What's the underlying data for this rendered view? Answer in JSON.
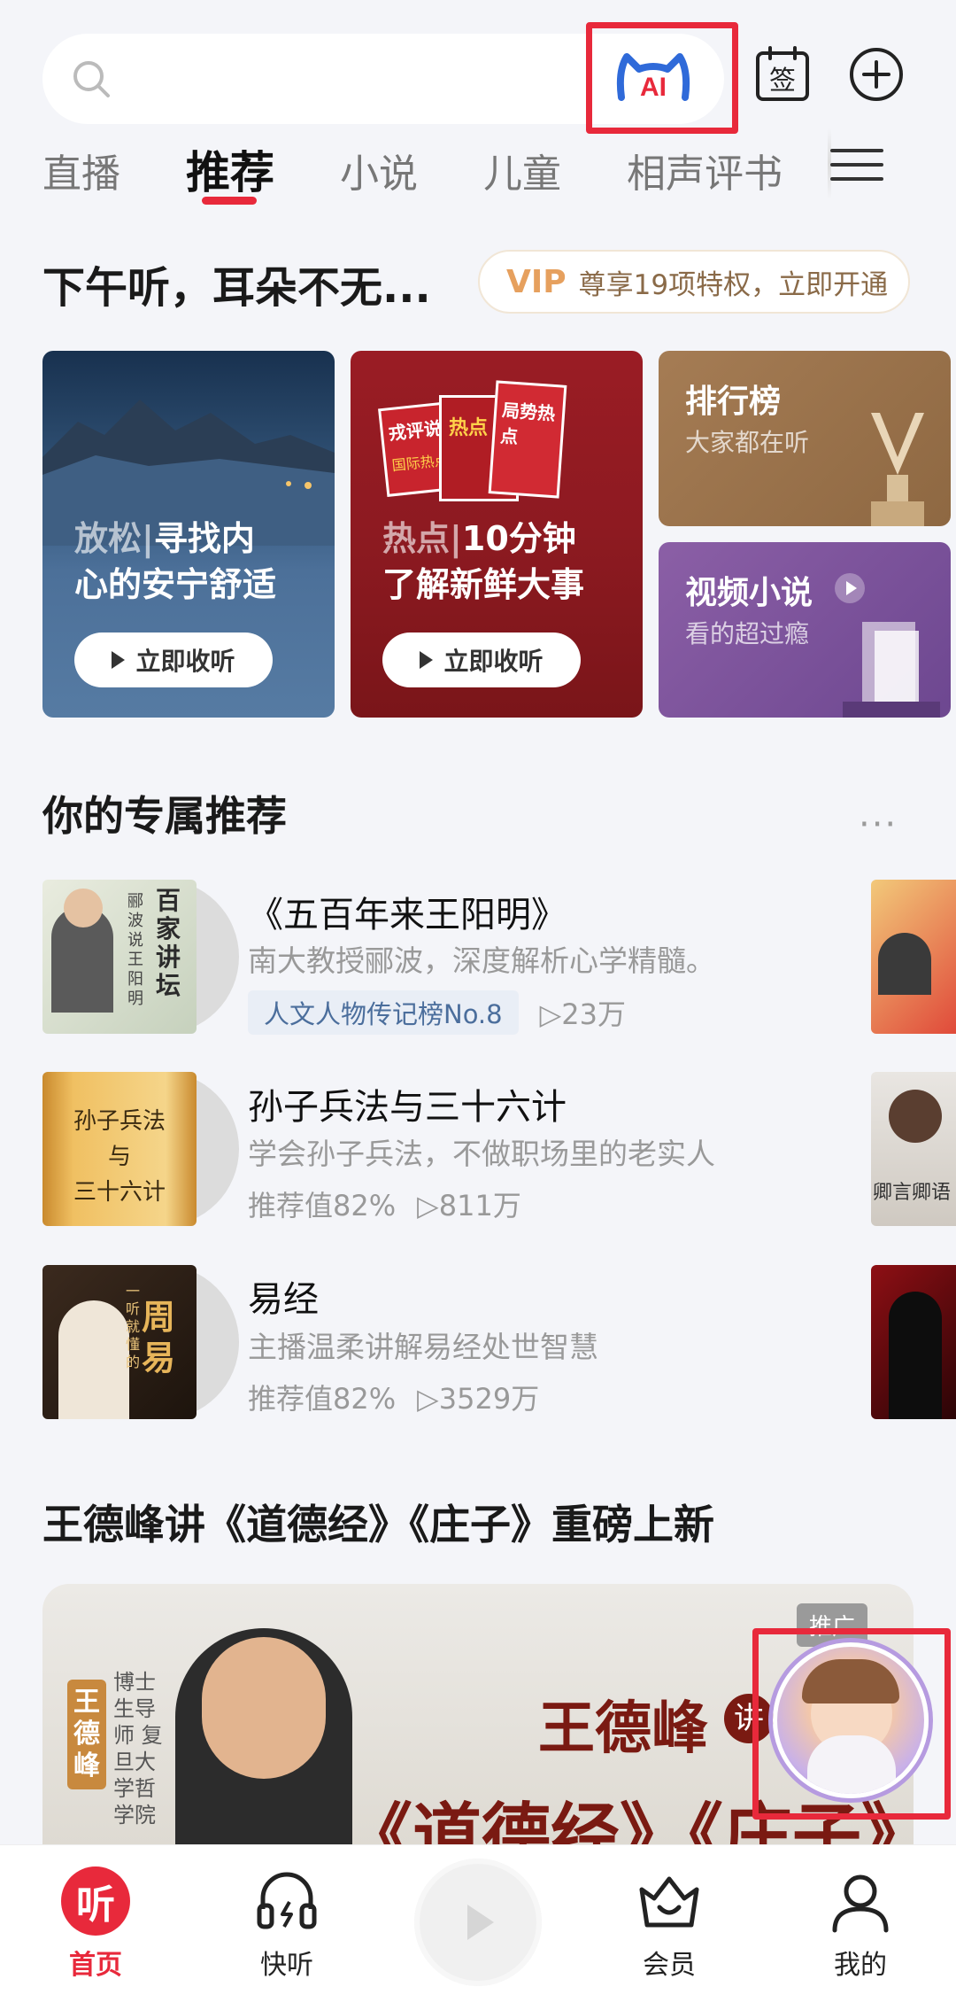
{
  "top_bar": {
    "ai_icon": "ai-cat-icon",
    "sign_label": "签",
    "plus_icon": "plus-circle-icon"
  },
  "tabs": [
    {
      "label": "直播"
    },
    {
      "label": "推荐"
    },
    {
      "label": "小说"
    },
    {
      "label": "儿童"
    },
    {
      "label": "相声评书"
    }
  ],
  "greeting": "下午听，耳朵不无...",
  "vip": {
    "tag": "VIP",
    "text": "尊享19项特权，立即开通"
  },
  "cards": {
    "relax": {
      "dim": "放松",
      "sep": "|",
      "line1_rest": "寻找内",
      "line2": "心的安宁舒适",
      "button": "立即收听"
    },
    "hot": {
      "dim": "热点",
      "sep": "|",
      "line1_rest": "10分钟",
      "line2": "了解新鲜大事",
      "button": "立即收听",
      "art_text_1": "戎评说",
      "art_text_2": "国际热点",
      "art_text_3": "热点",
      "art_text_4": "局势热点"
    },
    "rank": {
      "title": "排行榜",
      "subtitle": "大家都在听"
    },
    "video": {
      "title": "视频小说",
      "subtitle": "看的超过瘾"
    }
  },
  "recommend": {
    "title": "你的专属推荐",
    "more": "···",
    "items": [
      {
        "title": "《五百年来王阳明》",
        "subtitle": "南大教授郦波，深度解析心学精髓。",
        "tag": "人文人物传记榜No.8",
        "plays": "▷23万",
        "cover_text": "百家讲坛",
        "cover_side": "郦波说王阳明"
      },
      {
        "title": "孙子兵法与三十六计",
        "subtitle": "学会孙子兵法，不做职场里的老实人",
        "score": "推荐值82%",
        "plays": "▷811万",
        "cover_lines": [
          "孙子兵法",
          "与",
          "三十六计"
        ]
      },
      {
        "title": "易经",
        "subtitle": "主播温柔讲解易经处世智慧",
        "score": "推荐值82%",
        "plays": "▷3529万",
        "cover_text": "周易",
        "cover_side": "一听就懂的"
      }
    ],
    "peek_text_2": "卿言卿语"
  },
  "banner": {
    "title": "王德峰讲《道德经》《庄子》重磅上新",
    "promo": "推广",
    "name_badge": "王德峰",
    "caption": "博士生导师 复旦大学哲学院",
    "headline": "王德峰",
    "headline_badge": "讲",
    "book_title": "《道德经》《庄子》"
  },
  "nav": [
    {
      "label": "首页",
      "icon": "listen-logo-icon"
    },
    {
      "label": "快听",
      "icon": "headphones-icon"
    },
    {
      "label": "",
      "icon": "play-icon"
    },
    {
      "label": "会员",
      "icon": "crown-basket-icon"
    },
    {
      "label": "我的",
      "icon": "person-icon"
    }
  ],
  "colors": {
    "accent": "#e8293b",
    "vip": "#e6a05e",
    "tag_blue": "#4b6e9c"
  }
}
